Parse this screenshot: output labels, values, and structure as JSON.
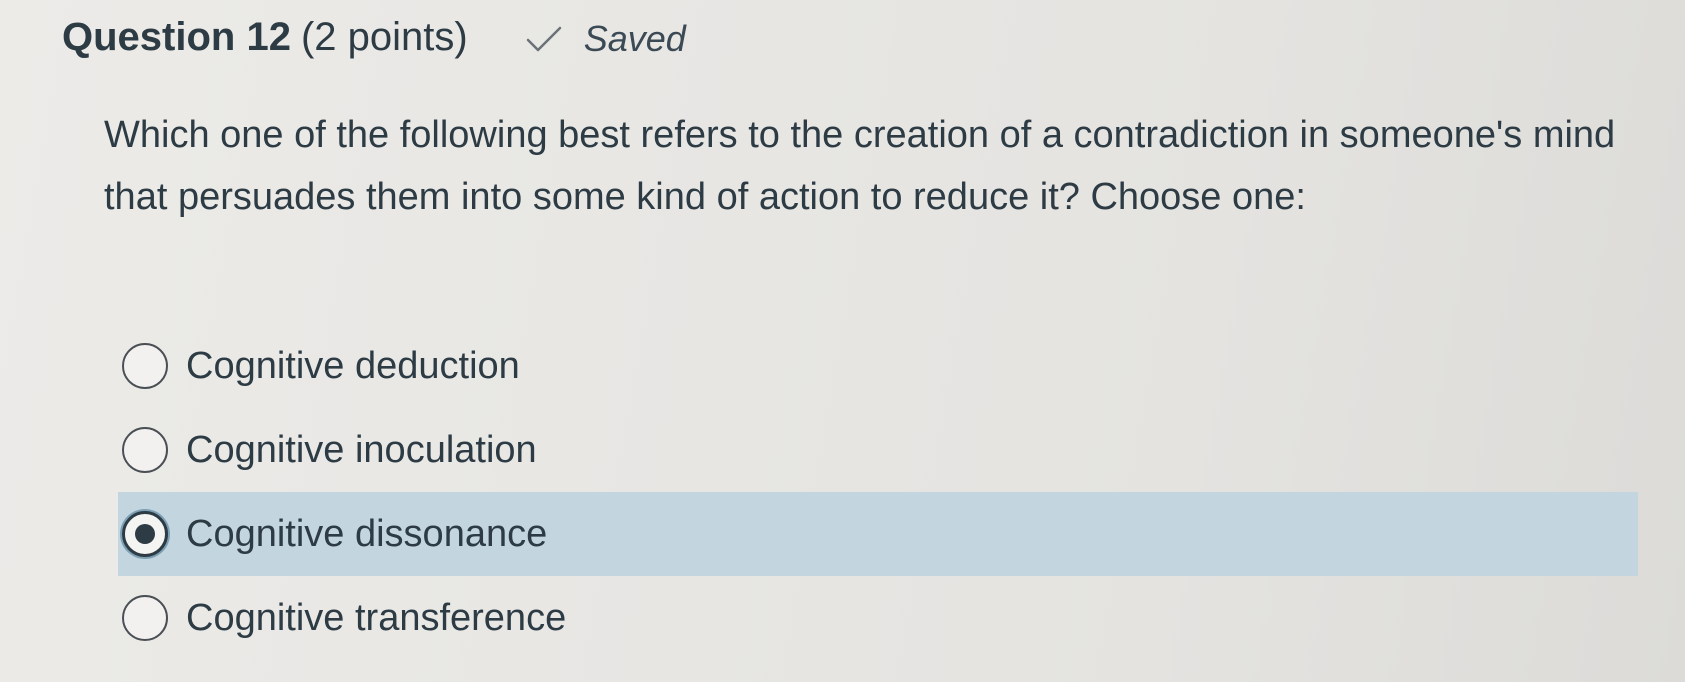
{
  "question": {
    "title": "Question 12",
    "points": "(2 points)",
    "status": "Saved",
    "status_icon": "checkmark-icon",
    "text": "Which one of the following best refers to the creation of a contradiction in someone's mind that persuades them into some kind of action to reduce it?  Choose one:"
  },
  "answers": [
    {
      "label": "Cognitive deduction",
      "selected": false
    },
    {
      "label": "Cognitive inoculation",
      "selected": false
    },
    {
      "label": "Cognitive dissonance",
      "selected": true
    },
    {
      "label": "Cognitive transference",
      "selected": false
    }
  ],
  "colors": {
    "text": "#2d3b45",
    "selected_highlight": "#c3d5df"
  }
}
